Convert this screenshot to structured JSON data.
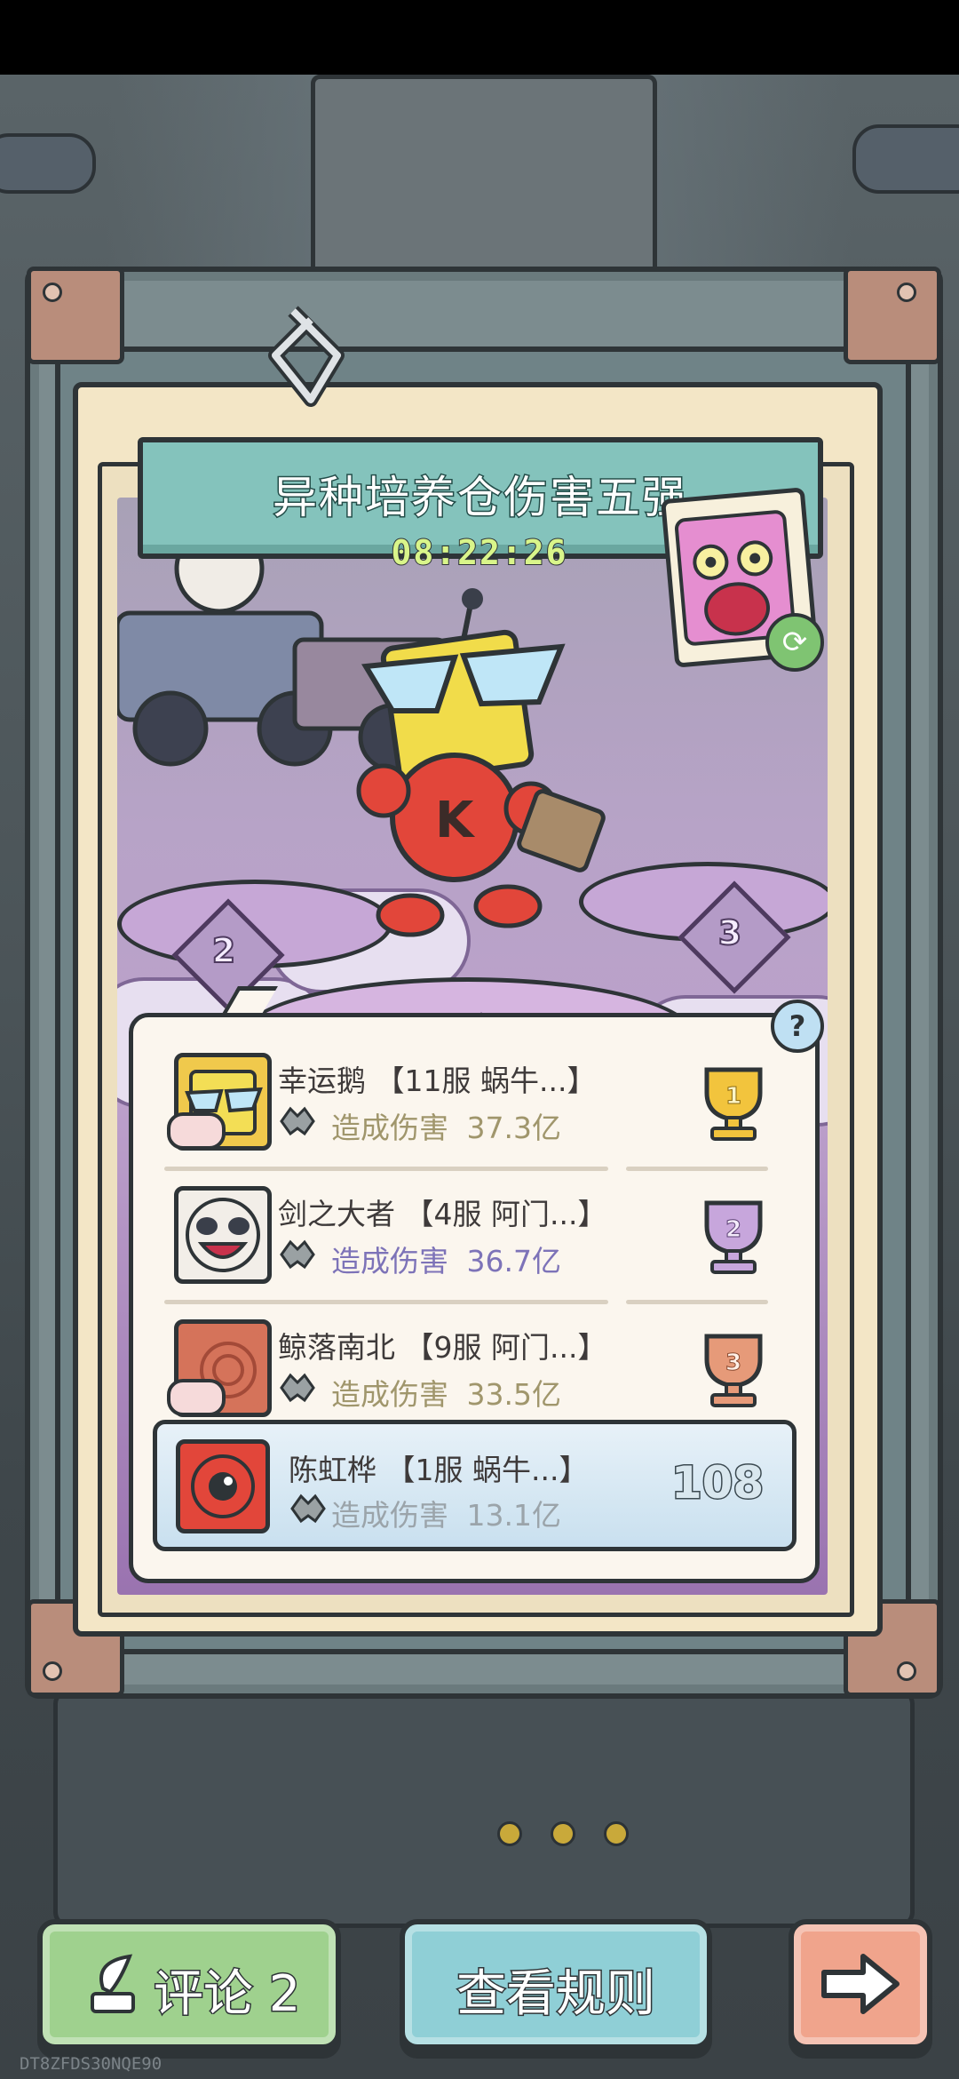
{
  "event": {
    "title": "异种培养仓伤害五强",
    "countdown": "08:22:26",
    "podium_ranks": [
      "1",
      "2",
      "3"
    ]
  },
  "leaderboard": {
    "help_icon": "question-mark-icon",
    "entries": [
      {
        "rank": 1,
        "name": "幸运鹅 【11服 蜗牛...】",
        "damage_label": "造成伤害",
        "damage_value": "37.3亿",
        "trophy": "gold-trophy-icon"
      },
      {
        "rank": 2,
        "name": "剑之大者 【4服 阿门...】",
        "damage_label": "造成伤害",
        "damage_value": "36.7亿",
        "trophy": "silver-trophy-icon"
      },
      {
        "rank": 3,
        "name": "鲸落南北 【9服 阿门...】",
        "damage_label": "造成伤害",
        "damage_value": "33.5亿",
        "trophy": "bronze-trophy-icon"
      }
    ],
    "self": {
      "rank": "108",
      "name": "陈虹桦 【1服 蜗牛...】",
      "damage_label": "造成伤害",
      "damage_value": "13.1亿"
    }
  },
  "buttons": {
    "comment_label": "评论 2",
    "rules_label": "查看规则",
    "next_icon": "arrow-right-icon"
  },
  "colors": {
    "banner": "#84c3bc",
    "timer": "#d9f58a",
    "damage_text": "#a0966c",
    "damage_text_highlight": "#7d73b8",
    "comment_button": "#9fd18e",
    "rules_button": "#8fcfd6",
    "next_button": "#f0a48c"
  },
  "footer": {
    "watermark": "DT8ZFDS30NQE90"
  }
}
